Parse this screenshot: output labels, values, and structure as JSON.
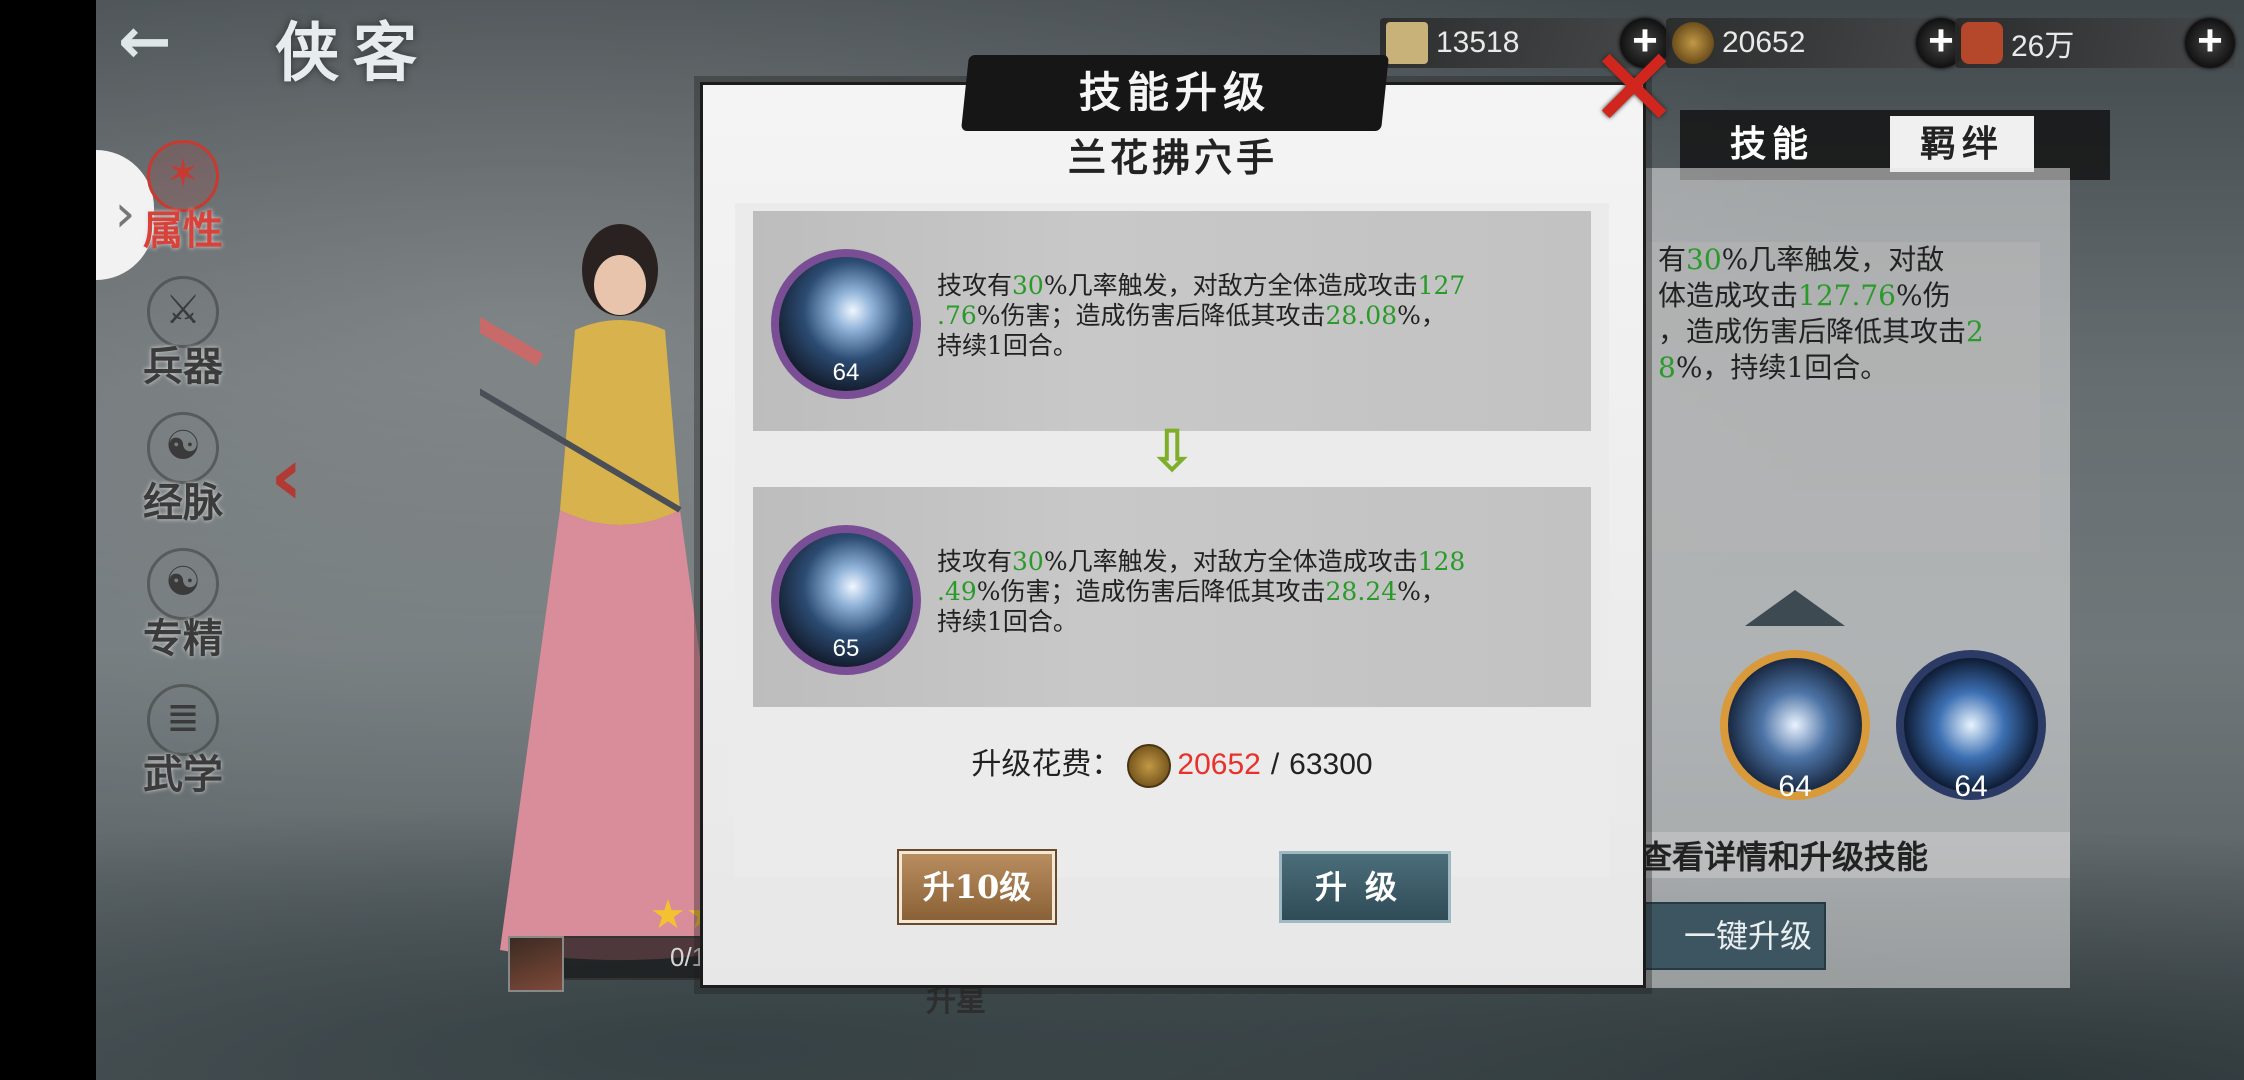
{
  "header": {
    "back_icon": "back-arrow-icon",
    "title": "侠客"
  },
  "resources": [
    {
      "name": "silver",
      "value": "13518",
      "icon": "silver-ingot-icon",
      "color": "#c9b27a"
    },
    {
      "name": "coin",
      "value": "20652",
      "icon": "copper-coin-icon",
      "color": "#a47a35"
    },
    {
      "name": "gourd",
      "value": "26万",
      "icon": "red-pouch-icon",
      "color": "#c04a2a"
    }
  ],
  "sidebar": {
    "items": [
      {
        "label": "属性",
        "active": true
      },
      {
        "label": "兵器"
      },
      {
        "label": "经脉"
      },
      {
        "label": "专精"
      },
      {
        "label": "武学"
      }
    ]
  },
  "character": {
    "progress_text": "0/1"
  },
  "bottom": {
    "star_up_label": "升星"
  },
  "right_panel": {
    "tabs": [
      "技能",
      "羁绊"
    ],
    "desc_lines": [
      {
        "pre": "有",
        "g": "30",
        "post": "%几率触发，对敌"
      },
      {
        "pre": "体造成攻击",
        "g": "127.76",
        "post": "%伤"
      },
      {
        "pre": "，造成伤害后降低其攻击",
        "g": "2",
        "post": ""
      },
      {
        "pre": "",
        "g": "8",
        "post": "%，持续1回合。"
      }
    ],
    "skill_levels": [
      "64",
      "64"
    ],
    "hint": "查看详情和升级技能",
    "one_key": "一键升级"
  },
  "modal": {
    "title": "技能升级",
    "skill_name": "兰花拂穴手",
    "current": {
      "level": "64",
      "t1": "技攻有",
      "chance": "30",
      "t2": "%几率触发，对敌方全体造成攻击",
      "dmg_a": "127",
      "dmg_b": ".76",
      "t3": "%伤害；造成伤害后降低其攻击",
      "reduce": "28.08",
      "t4": "%，",
      "t5": "持续1回合。"
    },
    "next": {
      "level": "65",
      "t1": "技攻有",
      "chance": "30",
      "t2": "%几率触发，对敌方全体造成攻击",
      "dmg_a": "128",
      "dmg_b": ".49",
      "t3": "%伤害；造成伤害后降低其攻击",
      "reduce": "28.24",
      "t4": "%，",
      "t5": "持续1回合。"
    },
    "cost_label": "升级花费：",
    "cost_have": "20652",
    "cost_sep": "/",
    "cost_need": "63300",
    "btn_up10": "升10级",
    "btn_up": "升级"
  }
}
